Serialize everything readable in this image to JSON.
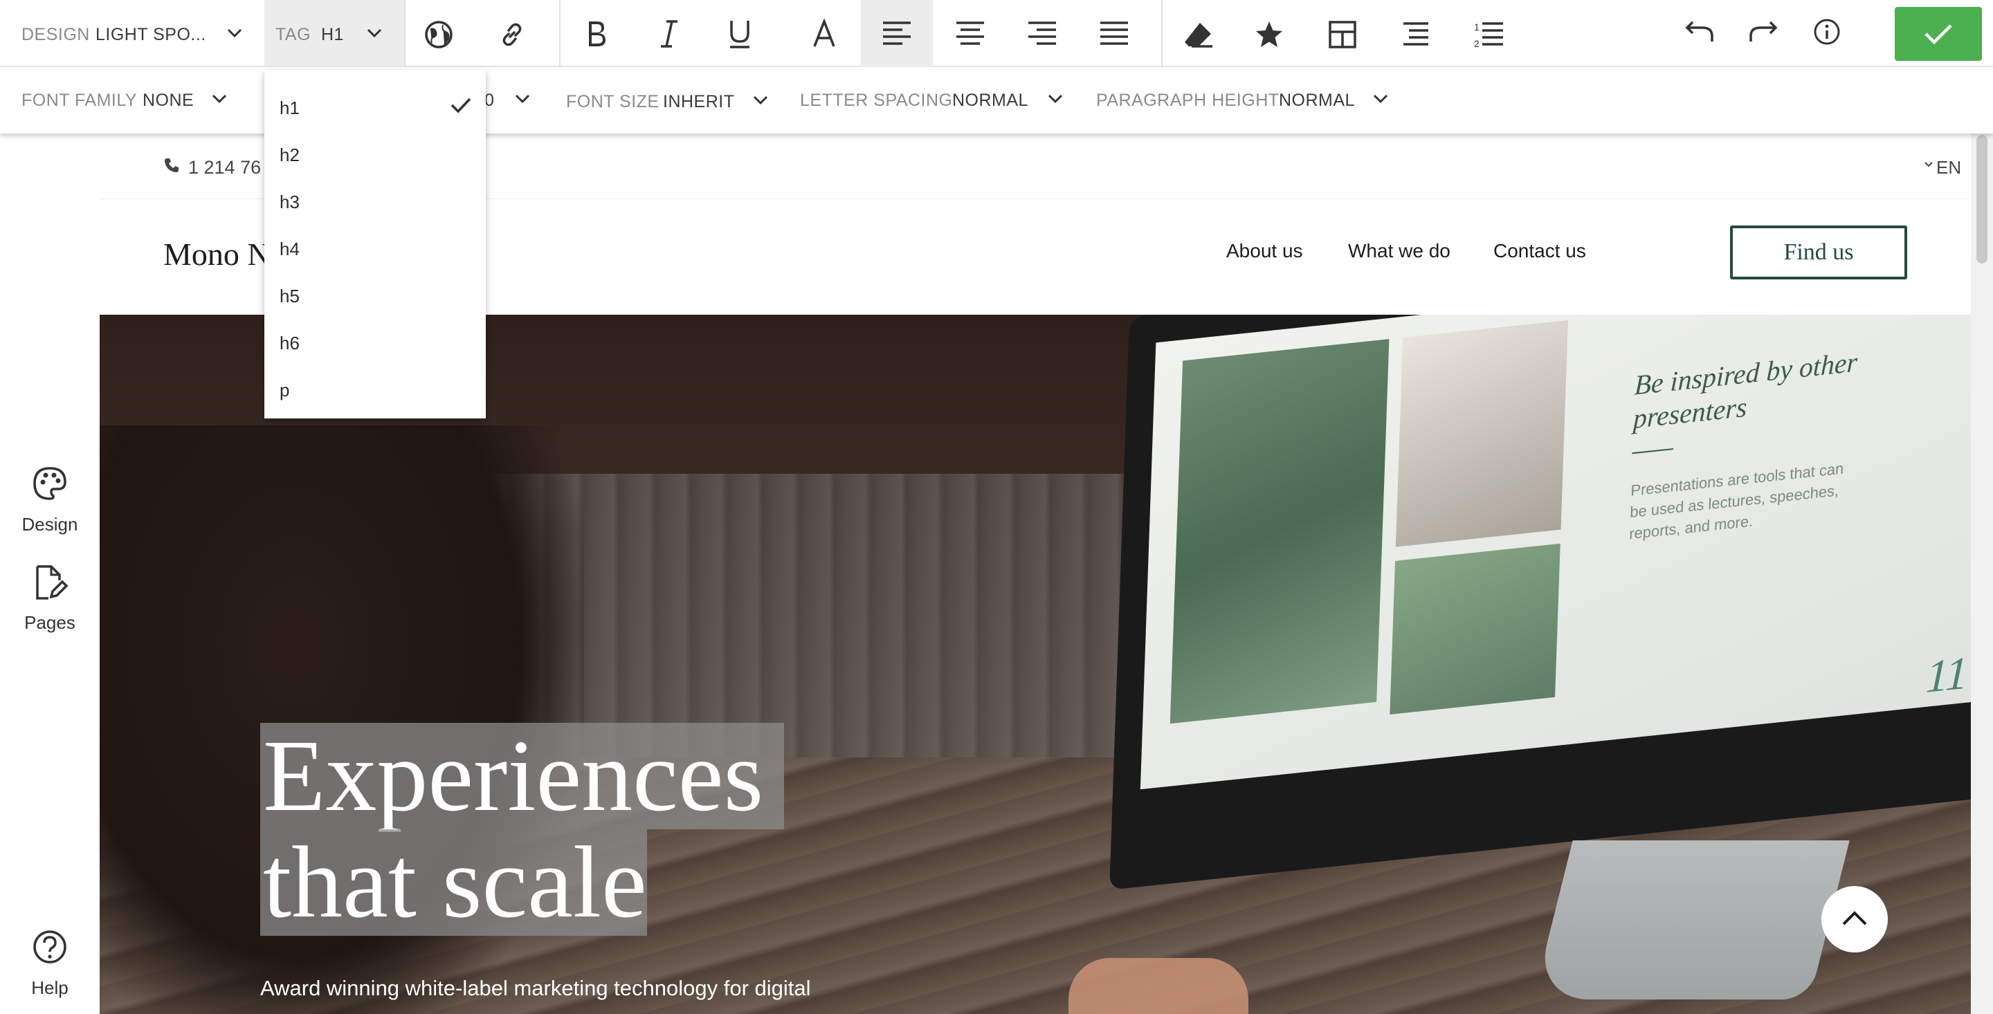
{
  "toolbar": {
    "design_label": "DESIGN",
    "design_value": "LIGHT SPO...",
    "tag_label": "TAG",
    "tag_value": "H1",
    "icons": [
      "globe-icon",
      "link-icon",
      "bold-icon",
      "italic-icon",
      "underline-icon",
      "text-color-icon",
      "align-left-icon",
      "align-center-icon",
      "align-right-icon",
      "align-justify-icon",
      "eraser-icon",
      "star-icon",
      "table-icon",
      "bullet-list-icon",
      "numbered-list-icon",
      "undo-icon",
      "redo-icon",
      "info-icon",
      "check-icon"
    ],
    "confirm_color": "#4caf50"
  },
  "toolbar2": {
    "font_family_label": "FONT FAMILY",
    "font_family_value": "NONE",
    "hidden_value": "0",
    "font_size_label": "FONT SIZE",
    "font_size_value": "INHERIT",
    "letter_spacing_label": "LETTER SPACING",
    "letter_spacing_value": "NORMAL",
    "paragraph_height_label": "PARAGRAPH HEIGHT",
    "paragraph_height_value": "NORMAL"
  },
  "tag_dropdown": {
    "options": [
      "h1",
      "h2",
      "h3",
      "h4",
      "h5",
      "h6",
      "p"
    ],
    "selected": "h1"
  },
  "sidebar": {
    "design_label": "Design",
    "pages_label": "Pages",
    "help_label": "Help"
  },
  "site": {
    "phone": "1 214 76",
    "language": "EN",
    "brand": "Mono N",
    "nav": [
      "About us",
      "What we do",
      "Contact us"
    ],
    "cta": "Find us",
    "hero_title_line1": "Experiences",
    "hero_title_line2": "that scale",
    "hero_subtitle": "Award winning white-label marketing technology for digital",
    "monitor_heading": "Be inspired by other presenters",
    "monitor_body": "Presentations are tools that can be used as lectures, speeches, reports, and more.",
    "monitor_number": "11"
  }
}
